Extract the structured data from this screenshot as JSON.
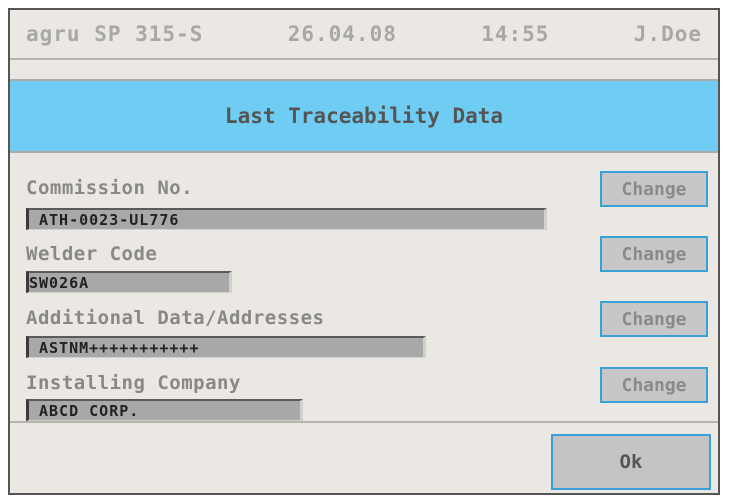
{
  "header": {
    "device": "agru SP 315-S",
    "date": "26.04.08",
    "time": "14:55",
    "user": "J.Doe"
  },
  "title": "Last Traceability Data",
  "fields": [
    {
      "label": "Commission No.",
      "value": "ATH-0023-UL776",
      "button": "Change"
    },
    {
      "label": "Welder Code",
      "value": "SW026A",
      "button": "Change"
    },
    {
      "label": "Additional Data/Addresses",
      "value": "ASTNM+++++++++++",
      "button": "Change"
    },
    {
      "label": "Installing Company",
      "value": "ABCD CORP.",
      "button": "Change"
    }
  ],
  "ok_label": "Ok",
  "colors": {
    "title_bg": "#6fcdf4",
    "panel_bg": "#ebe7e2",
    "button_border": "#3aa0d8"
  }
}
